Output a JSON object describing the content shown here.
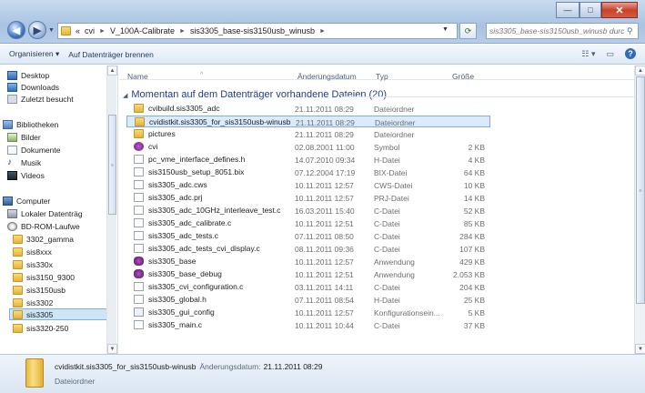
{
  "window": {
    "minimize_glyph": "—",
    "maximize_glyph": "□",
    "close_glyph": "✕"
  },
  "address": {
    "overflow": "«",
    "crumbs": [
      "cvi",
      "V_100A-Calibrate",
      "sis3305_base-sis3150usb_winusb"
    ],
    "sep": "►"
  },
  "search": {
    "placeholder": "sis3305_base-sis3150usb_winusb durc..."
  },
  "toolbar": {
    "organize": "Organisieren ▾",
    "burn": "Auf Datenträger brennen",
    "views_glyph": "☷ ▾",
    "preview_glyph": "▭",
    "help_glyph": "?"
  },
  "navpane": {
    "items": [
      {
        "label": "Desktop",
        "icon": "desktop-icon"
      },
      {
        "label": "Downloads",
        "icon": "downloads-icon"
      },
      {
        "label": "Zuletzt besucht",
        "icon": "recent-places-icon"
      },
      {
        "label": "Bibliotheken",
        "icon": "libraries-icon"
      },
      {
        "label": "Bilder",
        "icon": "pictures-icon"
      },
      {
        "label": "Dokumente",
        "icon": "documents-icon"
      },
      {
        "label": "Musik",
        "icon": "music-icon"
      },
      {
        "label": "Videos",
        "icon": "videos-icon"
      },
      {
        "label": "Computer",
        "icon": "computer-icon"
      },
      {
        "label": "Lokaler Datenträg",
        "icon": "drive-icon"
      },
      {
        "label": "BD-ROM-Laufwe",
        "icon": "disc-icon"
      },
      {
        "label": "3302_gamma",
        "icon": "folder-icon"
      },
      {
        "label": "sis8xxx",
        "icon": "folder-icon"
      },
      {
        "label": "sis330x",
        "icon": "folder-icon"
      },
      {
        "label": "sis3150_9300",
        "icon": "folder-icon"
      },
      {
        "label": "sis3150usb",
        "icon": "folder-icon"
      },
      {
        "label": "sis3302",
        "icon": "folder-icon"
      },
      {
        "label": "sis3305",
        "icon": "folder-icon"
      },
      {
        "label": "sis3320-250",
        "icon": "folder-icon"
      }
    ]
  },
  "columns": {
    "name": "Name",
    "date": "Änderungsdatum",
    "type": "Typ",
    "size": "Größe"
  },
  "group": {
    "title": "Momentan auf dem Datenträger vorhandene Dateien (20)",
    "caret": "◢"
  },
  "files": [
    {
      "name": "cvibuild.sis3305_adc",
      "date": "21.11.2011 08:29",
      "type": "Dateiordner",
      "size": "",
      "icon": "folder-icon"
    },
    {
      "name": "cvidistkit.sis3305_for_sis3150usb-winusb",
      "date": "21.11.2011 08:29",
      "type": "Dateiordner",
      "size": "",
      "icon": "folder-icon"
    },
    {
      "name": "pictures",
      "date": "21.11.2011 08:29",
      "type": "Dateiordner",
      "size": "",
      "icon": "folder-icon"
    },
    {
      "name": "cvi",
      "date": "02.08.2001 11:00",
      "type": "Symbol",
      "size": "2 KB",
      "icon": "cvi-symbol-icon"
    },
    {
      "name": "pc_vme_interface_defines.h",
      "date": "14.07.2010 09:34",
      "type": "H-Datei",
      "size": "4 KB",
      "icon": "file-icon"
    },
    {
      "name": "sis3150usb_setup_8051.bix",
      "date": "07.12.2004 17:19",
      "type": "BIX-Datei",
      "size": "64 KB",
      "icon": "file-icon"
    },
    {
      "name": "sis3305_adc.cws",
      "date": "10.11.2011 12:57",
      "type": "CWS-Datei",
      "size": "10 KB",
      "icon": "file-icon"
    },
    {
      "name": "sis3305_adc.prj",
      "date": "10.11.2011 12:57",
      "type": "PRJ-Datei",
      "size": "14 KB",
      "icon": "file-icon"
    },
    {
      "name": "sis3305_adc_10GHz_interleave_test.c",
      "date": "16.03.2011 15:40",
      "type": "C-Datei",
      "size": "52 KB",
      "icon": "c-file-icon"
    },
    {
      "name": "sis3305_adc_calibrate.c",
      "date": "10.11.2011 12:51",
      "type": "C-Datei",
      "size": "85 KB",
      "icon": "c-file-icon"
    },
    {
      "name": "sis3305_adc_tests.c",
      "date": "07.11.2011 08:50",
      "type": "C-Datei",
      "size": "284 KB",
      "icon": "c-file-icon"
    },
    {
      "name": "sis3305_adc_tests_cvi_display.c",
      "date": "08.11.2011 09:36",
      "type": "C-Datei",
      "size": "107 KB",
      "icon": "c-file-icon"
    },
    {
      "name": "sis3305_base",
      "date": "10.11.2011 12:57",
      "type": "Anwendung",
      "size": "429 KB",
      "icon": "application-icon"
    },
    {
      "name": "sis3305_base_debug",
      "date": "10.11.2011 12:51",
      "type": "Anwendung",
      "size": "2.053 KB",
      "icon": "application-icon"
    },
    {
      "name": "sis3305_cvi_configuration.c",
      "date": "03.11.2011 14:11",
      "type": "C-Datei",
      "size": "204 KB",
      "icon": "c-file-icon"
    },
    {
      "name": "sis3305_global.h",
      "date": "07.11.2011 08:54",
      "type": "H-Datei",
      "size": "25 KB",
      "icon": "file-icon"
    },
    {
      "name": "sis3305_gui_config",
      "date": "10.11.2011 12:57",
      "type": "Konfigurationsein...",
      "size": "5 KB",
      "icon": "config-icon"
    },
    {
      "name": "sis3305_main.c",
      "date": "10.11.2011 10:44",
      "type": "C-Datei",
      "size": "37 KB",
      "icon": "c-file-icon"
    }
  ],
  "details": {
    "name": "cvidistkit.sis3305_for_sis3150usb-winusb",
    "date_label": "Änderungsdatum:",
    "date": "21.11.2011 08:29",
    "type": "Dateiordner"
  },
  "colors": {
    "selection": "#d9ebfc",
    "selection_border": "#84acdd",
    "group_title": "#1e3e8c",
    "title_bar": "#a9c3e2"
  }
}
